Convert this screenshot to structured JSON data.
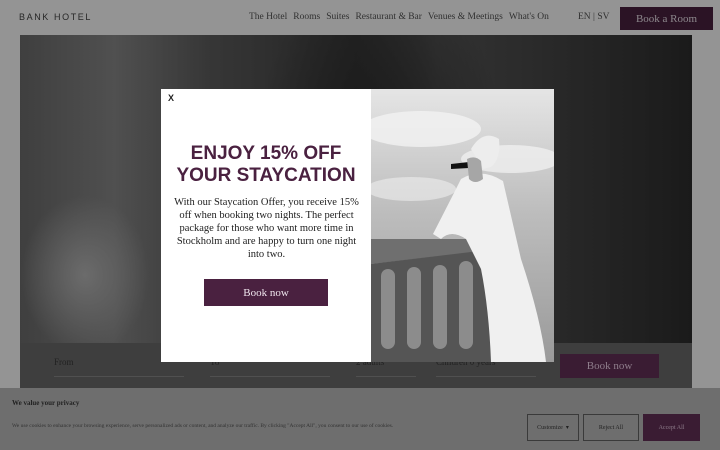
{
  "header": {
    "logo": "BANK HOTEL",
    "nav": [
      "The Hotel",
      "Rooms",
      "Suites",
      "Restaurant & Bar",
      "Venues & Meetings",
      "What's On"
    ],
    "lang": "EN | SV",
    "cta": "Book a Room"
  },
  "booking": {
    "from_label": "From",
    "to_label": "To",
    "adults_label": "2 adults",
    "children_label": "Children 0 years",
    "book_now": "Book now"
  },
  "cookie": {
    "title": "We value your privacy",
    "text": "We use cookies to enhance your browsing experience, serve personalized ads or content, and analyze our traffic. By clicking \"Accept All\", you consent to our use of cookies.",
    "customize": "Customize",
    "reject": "Reject All",
    "accept": "Accept All"
  },
  "modal": {
    "close": "X",
    "title_line1": "ENJOY 15% OFF",
    "title_line2": "YOUR STAYCATION",
    "body": "With our Staycation Offer, you receive 15% off when booking two nights. The perfect package for those who want more time in Stockholm and are happy to turn one night into two.",
    "button": "Book now"
  },
  "colors": {
    "brand": "#4a2140"
  }
}
